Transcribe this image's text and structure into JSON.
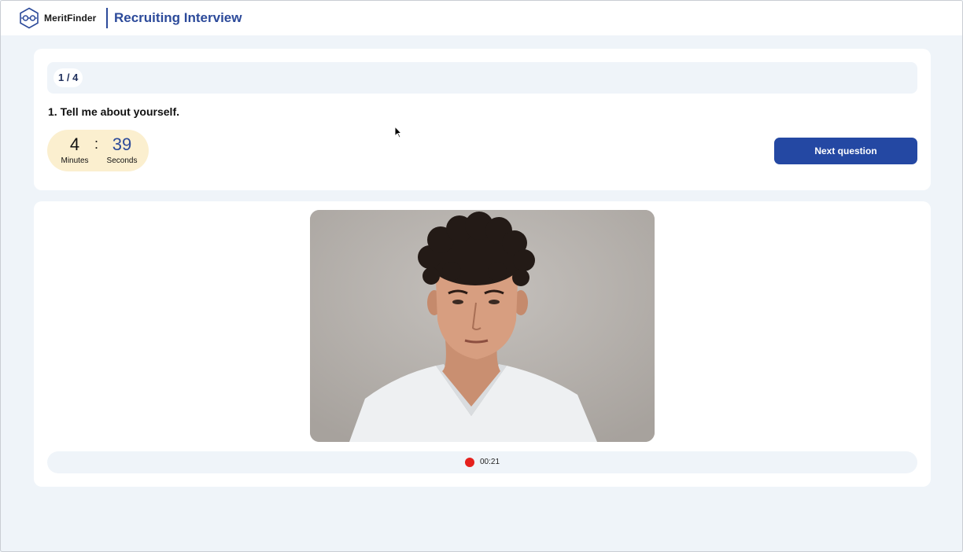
{
  "header": {
    "brand": "MeritFinder",
    "title": "Recruiting Interview"
  },
  "question": {
    "progress": "1 / 4",
    "text": "1. Tell me about yourself.",
    "timer": {
      "minutes": "4",
      "minutes_label": "Minutes",
      "separator": ":",
      "seconds": "39",
      "seconds_label": "Seconds"
    },
    "next_button": "Next question"
  },
  "video": {
    "recording_time": "00:21",
    "recording_indicator_color": "#e5211d"
  },
  "colors": {
    "accent": "#2448a3",
    "page_background": "#eff4f9",
    "timer_background": "#fbefcf"
  },
  "icons": {
    "logo": "meritfinder-logo-icon",
    "recording": "record-dot-icon",
    "cursor": "mouse-pointer-icon"
  }
}
